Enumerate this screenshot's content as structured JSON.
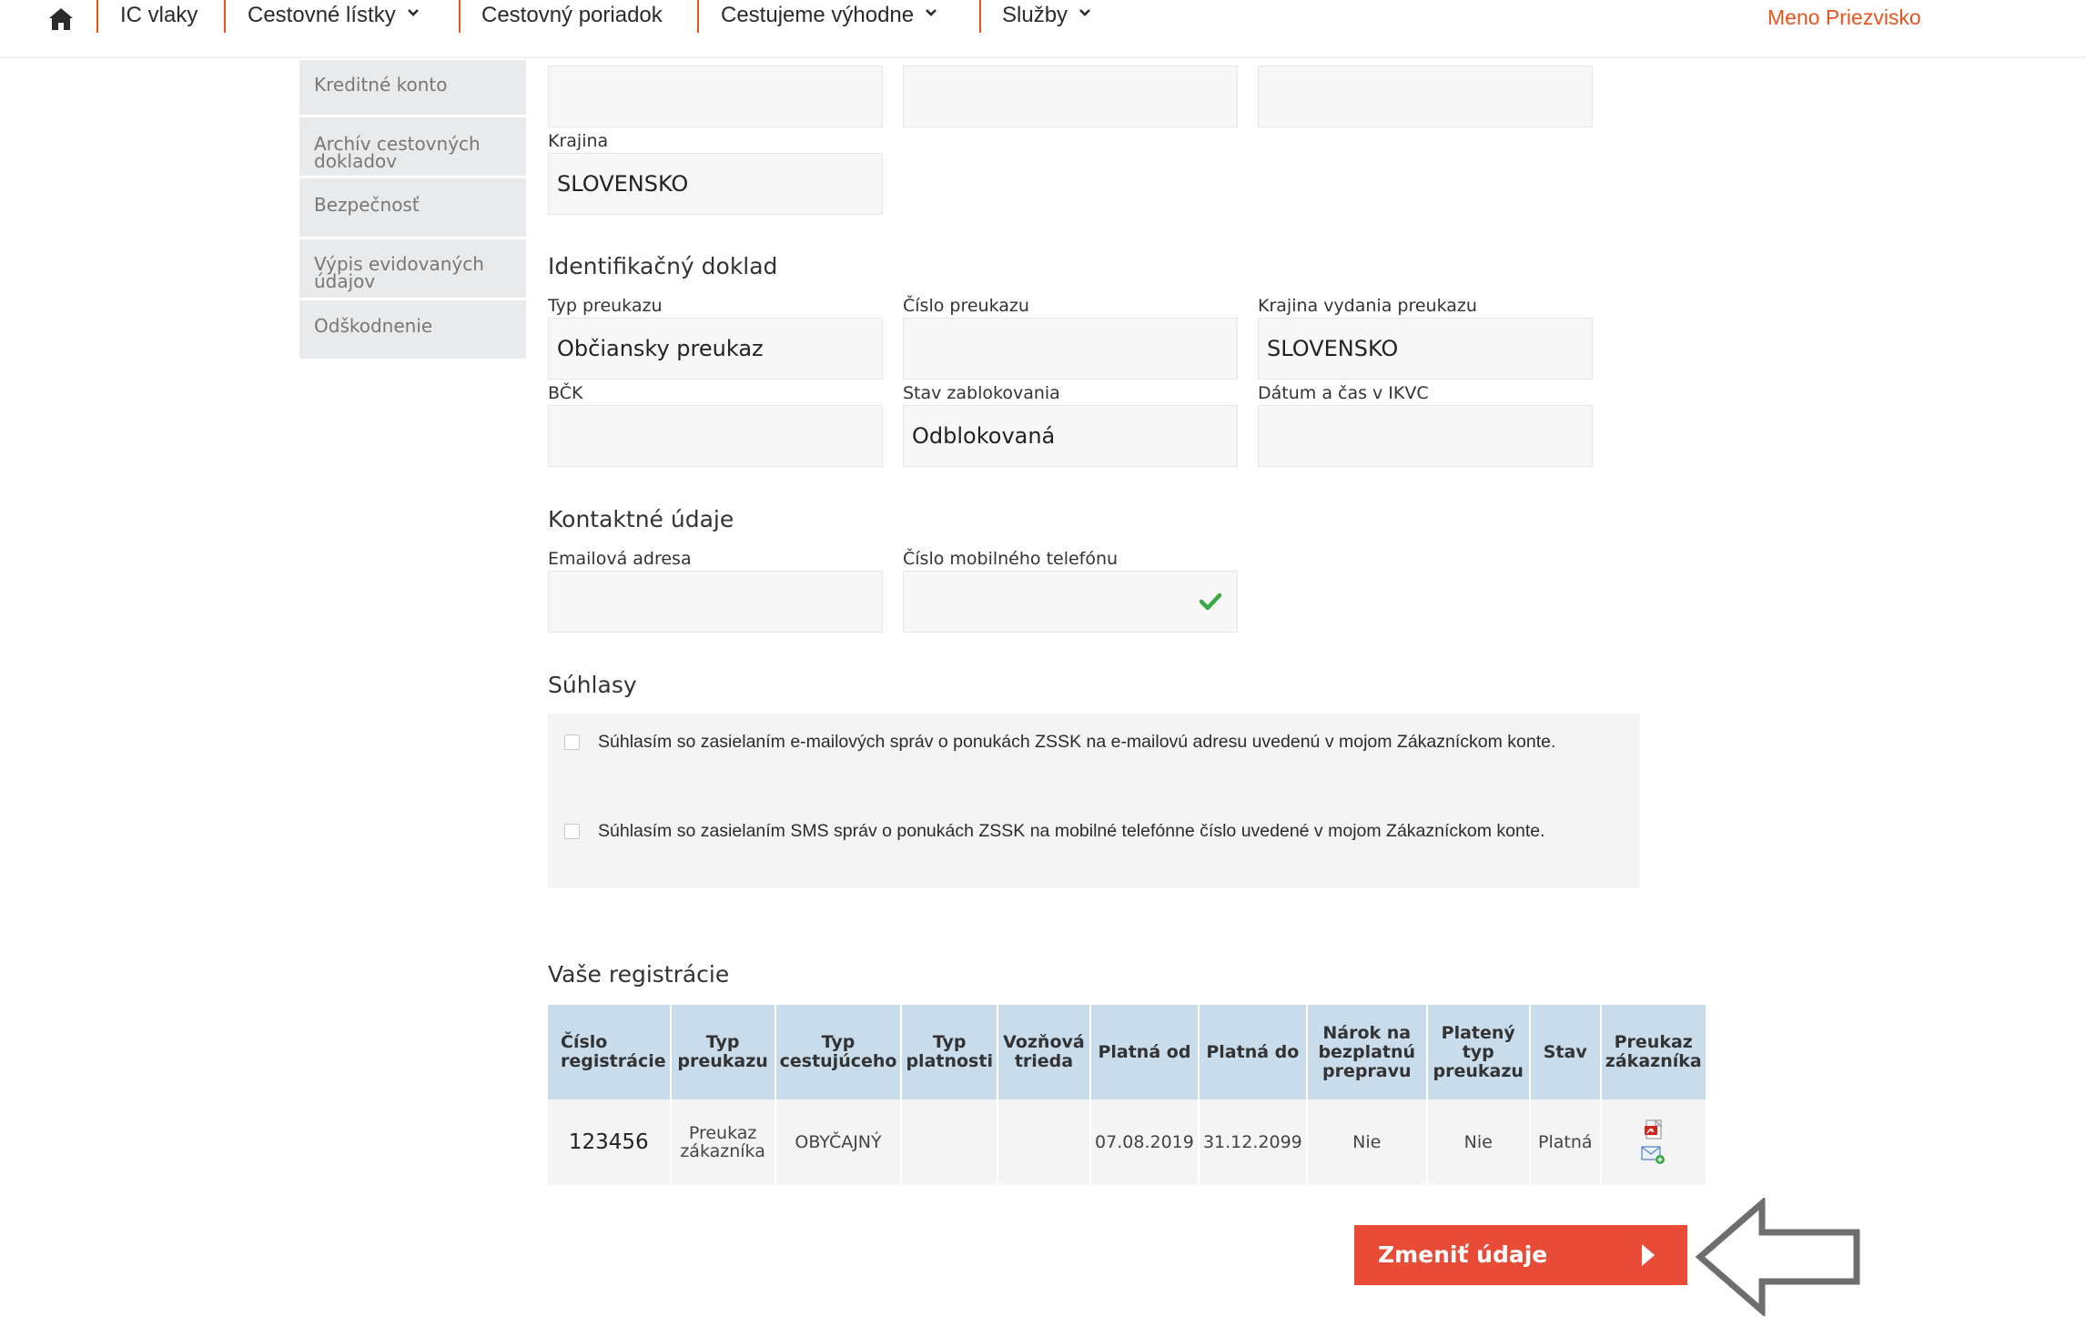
{
  "nav": {
    "items": [
      {
        "label": "IC vlaky",
        "has_dropdown": false
      },
      {
        "label": "Cestovné lístky",
        "has_dropdown": true
      },
      {
        "label": "Cestovný poriadok",
        "has_dropdown": false
      },
      {
        "label": "Cestujeme výhodne",
        "has_dropdown": true
      },
      {
        "label": "Služby",
        "has_dropdown": true
      }
    ],
    "user_name": "Meno Priezvisko",
    "accent_color": "#e8541e"
  },
  "sidebar": {
    "items": [
      {
        "label": "Kreditné konto"
      },
      {
        "label": "Archív cestovných dokladov"
      },
      {
        "label": "Bezpečnosť"
      },
      {
        "label": "Výpis evidovaných údajov"
      },
      {
        "label": "Odškodnenie"
      }
    ]
  },
  "address": {
    "country_label": "Krajina",
    "country_value": "SLOVENSKO"
  },
  "id_document": {
    "title": "Identifikačný doklad",
    "type_label": "Typ preukazu",
    "type_value": "Občiansky preukaz",
    "number_label": "Číslo preukazu",
    "number_value": "",
    "issuing_country_label": "Krajina vydania preukazu",
    "issuing_country_value": "SLOVENSKO",
    "bck_label": "BČK",
    "bck_value": "",
    "block_state_label": "Stav zablokovania",
    "block_state_value": "Odblokovaná",
    "ikvc_label": "Dátum a čas v IKVC",
    "ikvc_value": ""
  },
  "contact": {
    "title": "Kontaktné údaje",
    "email_label": "Emailová adresa",
    "email_value": "",
    "phone_label": "Číslo mobilného telefónu",
    "phone_value": ""
  },
  "consents": {
    "title": "Súhlasy",
    "items": [
      {
        "text": "Súhlasím so zasielaním e-mailových správ o ponukách ZSSK na e-mailovú adresu uvedenú v mojom Zákazníckom konte.",
        "checked": false
      },
      {
        "text": "Súhlasím so zasielaním SMS správ o ponukách ZSSK na mobilné telefónne číslo uvedené v mojom Zákazníckom konte.",
        "checked": false
      }
    ]
  },
  "registrations": {
    "title": "Vaše registrácie",
    "columns": [
      "Číslo registrácie",
      "Typ preukazu",
      "Typ cestujúceho",
      "Typ platnosti",
      "Vozňová trieda",
      "Platná od",
      "Platná do",
      "Nárok na bezplatnú prepravu",
      "Platený typ preukazu",
      "Stav",
      "Preukaz zákazníka"
    ],
    "rows": [
      {
        "number": "123456",
        "card_type": "Preukaz zákazníka",
        "passenger_type": "OBYČAJNÝ",
        "validity_type": "",
        "car_class": "",
        "valid_from": "07.08.2019",
        "valid_to": "31.12.2099",
        "free_transport": "Nie",
        "paid_card_type": "Nie",
        "status": "Platná",
        "card_icons": [
          "pdf-icon",
          "email-send-icon"
        ]
      }
    ]
  },
  "actions": {
    "change_label": "Zmeniť údaje",
    "change_color": "#e84c37"
  }
}
